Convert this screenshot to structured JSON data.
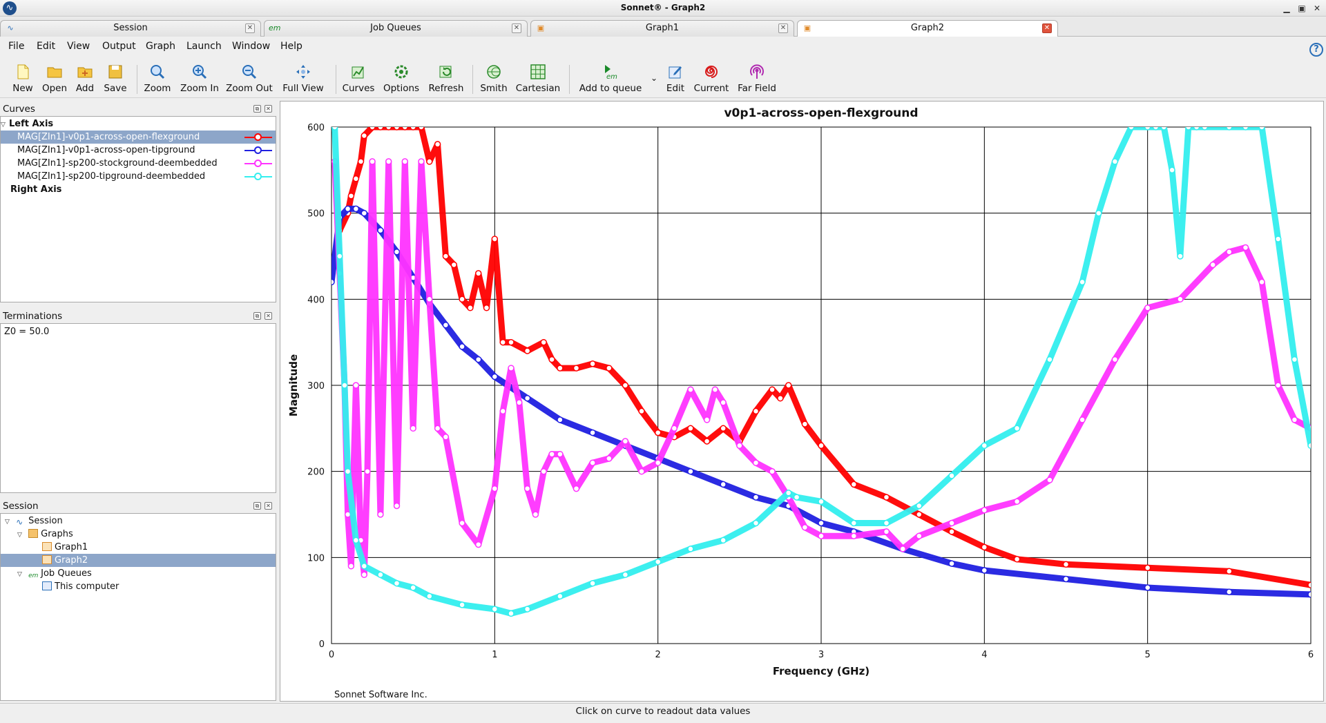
{
  "window": {
    "title": "Sonnet® - Graph2"
  },
  "tabs": [
    {
      "label": "Session",
      "icon": "session-icon"
    },
    {
      "label": "Job Queues",
      "icon": "job-queue-icon"
    },
    {
      "label": "Graph1",
      "icon": "graph-icon"
    },
    {
      "label": "Graph2",
      "icon": "graph-icon",
      "active": true
    }
  ],
  "menu": [
    "File",
    "Edit",
    "View",
    "Output",
    "Graph",
    "Launch",
    "Window",
    "Help"
  ],
  "toolbar": [
    {
      "label": "New",
      "icon": "new-file-icon"
    },
    {
      "label": "Open",
      "icon": "open-folder-icon"
    },
    {
      "label": "Add",
      "icon": "add-icon"
    },
    {
      "label": "Save",
      "icon": "save-icon"
    },
    {
      "label": "Zoom",
      "icon": "zoom-icon"
    },
    {
      "label": "Zoom In",
      "icon": "zoom-in-icon"
    },
    {
      "label": "Zoom Out",
      "icon": "zoom-out-icon"
    },
    {
      "label": "Full View",
      "icon": "full-view-icon"
    },
    {
      "label": "Curves",
      "icon": "curves-icon"
    },
    {
      "label": "Options",
      "icon": "options-icon"
    },
    {
      "label": "Refresh",
      "icon": "refresh-icon"
    },
    {
      "label": "Smith",
      "icon": "smith-chart-icon"
    },
    {
      "label": "Cartesian",
      "icon": "cartesian-grid-icon"
    },
    {
      "label": "Add to queue",
      "icon": "em-queue-icon"
    },
    {
      "label": "Edit",
      "icon": "edit-icon"
    },
    {
      "label": "Current",
      "icon": "current-spiral-icon"
    },
    {
      "label": "Far Field",
      "icon": "far-field-icon"
    }
  ],
  "curves_panel": {
    "title": "Curves",
    "left_axis_label": "Left Axis",
    "right_axis_label": "Right Axis",
    "items": [
      {
        "label": "MAG[ZIn1]-v0p1-across-open-flexground",
        "color": "#ff0000",
        "selected": true
      },
      {
        "label": "MAG[ZIn1]-v0p1-across-open-tipground",
        "color": "#2020e0"
      },
      {
        "label": "MAG[ZIn1]-sp200-stockground-deembedded",
        "color": "#ff33ff"
      },
      {
        "label": "MAG[ZIn1]-sp200-tipground-deembedded",
        "color": "#33eeee"
      }
    ]
  },
  "terminations_panel": {
    "title": "Terminations",
    "value": "Z0 = 50.0"
  },
  "session_panel": {
    "title": "Session",
    "tree": [
      {
        "label": "Session",
        "icon": "session-icon"
      },
      {
        "label": "Graphs",
        "icon": "folder-icon"
      },
      {
        "label": "Graph1",
        "icon": "graph-icon"
      },
      {
        "label": "Graph2",
        "icon": "graph-icon",
        "selected": true
      },
      {
        "label": "Job Queues",
        "icon": "job-queue-icon"
      },
      {
        "label": "This computer",
        "icon": "computer-icon"
      }
    ]
  },
  "graph": {
    "credit": "Sonnet Software Inc."
  },
  "status": {
    "message": "Click on curve to readout data values"
  },
  "chart_data": {
    "type": "line",
    "title": "v0p1-across-open-flexground",
    "xlabel": "Frequency (GHz)",
    "ylabel": "Magnitude",
    "xlim": [
      0,
      6
    ],
    "ylim": [
      0,
      600
    ],
    "xticks": [
      0,
      1,
      2,
      3,
      4,
      5,
      6
    ],
    "yticks": [
      0,
      100,
      200,
      300,
      400,
      500,
      600
    ],
    "grid": true,
    "series": [
      {
        "name": "MAG[ZIn1]-v0p1-across-open-flexground",
        "color": "#ff0000",
        "x": [
          0.05,
          0.1,
          0.12,
          0.15,
          0.18,
          0.2,
          0.25,
          0.3,
          0.35,
          0.4,
          0.45,
          0.5,
          0.55,
          0.6,
          0.65,
          0.7,
          0.75,
          0.8,
          0.85,
          0.9,
          0.95,
          1.0,
          1.05,
          1.1,
          1.2,
          1.3,
          1.35,
          1.4,
          1.5,
          1.6,
          1.7,
          1.8,
          1.9,
          2.0,
          2.1,
          2.2,
          2.3,
          2.4,
          2.5,
          2.6,
          2.7,
          2.75,
          2.8,
          2.9,
          3.0,
          3.2,
          3.4,
          3.6,
          3.8,
          4.0,
          4.2,
          4.5,
          5.0,
          5.5,
          6.0
        ],
        "y": [
          480,
          500,
          520,
          540,
          560,
          590,
          600,
          600,
          600,
          600,
          600,
          600,
          600,
          560,
          580,
          450,
          440,
          400,
          390,
          430,
          390,
          470,
          350,
          350,
          340,
          350,
          330,
          320,
          320,
          325,
          320,
          300,
          270,
          245,
          240,
          250,
          235,
          250,
          235,
          270,
          295,
          285,
          300,
          255,
          230,
          185,
          170,
          150,
          130,
          112,
          98,
          92,
          88,
          84,
          68
        ]
      },
      {
        "name": "MAG[ZIn1]-v0p1-across-open-tipground",
        "color": "#2020e0",
        "x": [
          0.0,
          0.05,
          0.1,
          0.15,
          0.2,
          0.3,
          0.4,
          0.5,
          0.6,
          0.7,
          0.8,
          0.9,
          1.0,
          1.2,
          1.4,
          1.6,
          1.8,
          2.0,
          2.2,
          2.4,
          2.6,
          2.8,
          3.0,
          3.2,
          3.5,
          3.8,
          4.0,
          4.5,
          5.0,
          5.5,
          6.0
        ],
        "y": [
          420,
          495,
          505,
          505,
          500,
          480,
          455,
          425,
          395,
          370,
          345,
          330,
          310,
          285,
          260,
          245,
          230,
          215,
          200,
          185,
          170,
          160,
          140,
          130,
          110,
          93,
          85,
          75,
          65,
          60,
          57
        ]
      },
      {
        "name": "MAG[ZIn1]-sp200-stockground-deembedded",
        "color": "#ff33ff",
        "x": [
          0.02,
          0.05,
          0.08,
          0.1,
          0.12,
          0.15,
          0.18,
          0.2,
          0.22,
          0.25,
          0.3,
          0.35,
          0.4,
          0.45,
          0.5,
          0.55,
          0.6,
          0.65,
          0.7,
          0.8,
          0.9,
          1.0,
          1.05,
          1.1,
          1.15,
          1.2,
          1.25,
          1.3,
          1.35,
          1.4,
          1.5,
          1.6,
          1.7,
          1.8,
          1.9,
          2.0,
          2.1,
          2.2,
          2.3,
          2.35,
          2.4,
          2.5,
          2.6,
          2.7,
          2.8,
          2.9,
          3.0,
          3.2,
          3.4,
          3.5,
          3.6,
          3.8,
          4.0,
          4.2,
          4.4,
          4.6,
          4.8,
          5.0,
          5.2,
          5.4,
          5.5,
          5.6,
          5.7,
          5.8,
          5.9,
          6.0
        ],
        "y": [
          560,
          430,
          300,
          150,
          90,
          300,
          120,
          80,
          200,
          560,
          150,
          560,
          160,
          560,
          250,
          560,
          400,
          250,
          240,
          140,
          115,
          180,
          270,
          320,
          280,
          180,
          150,
          200,
          220,
          220,
          180,
          210,
          215,
          235,
          200,
          210,
          250,
          295,
          260,
          295,
          280,
          230,
          210,
          200,
          170,
          135,
          125,
          125,
          130,
          110,
          125,
          140,
          155,
          165,
          190,
          260,
          330,
          390,
          400,
          440,
          455,
          460,
          420,
          300,
          260,
          250
        ]
      },
      {
        "name": "MAG[ZIn1]-sp200-tipground-deembedded",
        "color": "#33eeee",
        "x": [
          0.02,
          0.05,
          0.08,
          0.1,
          0.15,
          0.2,
          0.3,
          0.4,
          0.5,
          0.6,
          0.8,
          1.0,
          1.1,
          1.2,
          1.4,
          1.6,
          1.8,
          2.0,
          2.2,
          2.4,
          2.6,
          2.8,
          2.85,
          3.0,
          3.2,
          3.4,
          3.6,
          3.8,
          4.0,
          4.2,
          4.4,
          4.6,
          4.7,
          4.8,
          4.9,
          5.0,
          5.05,
          5.1,
          5.15,
          5.2,
          5.25,
          5.3,
          5.35,
          5.5,
          5.6,
          5.7,
          5.8,
          5.9,
          6.0
        ],
        "y": [
          600,
          450,
          300,
          200,
          120,
          90,
          80,
          70,
          65,
          55,
          45,
          40,
          35,
          40,
          55,
          70,
          80,
          95,
          110,
          120,
          140,
          175,
          170,
          165,
          140,
          140,
          160,
          195,
          230,
          250,
          330,
          420,
          500,
          560,
          600,
          600,
          600,
          600,
          550,
          450,
          600,
          600,
          600,
          600,
          600,
          600,
          470,
          330,
          230
        ]
      }
    ]
  }
}
